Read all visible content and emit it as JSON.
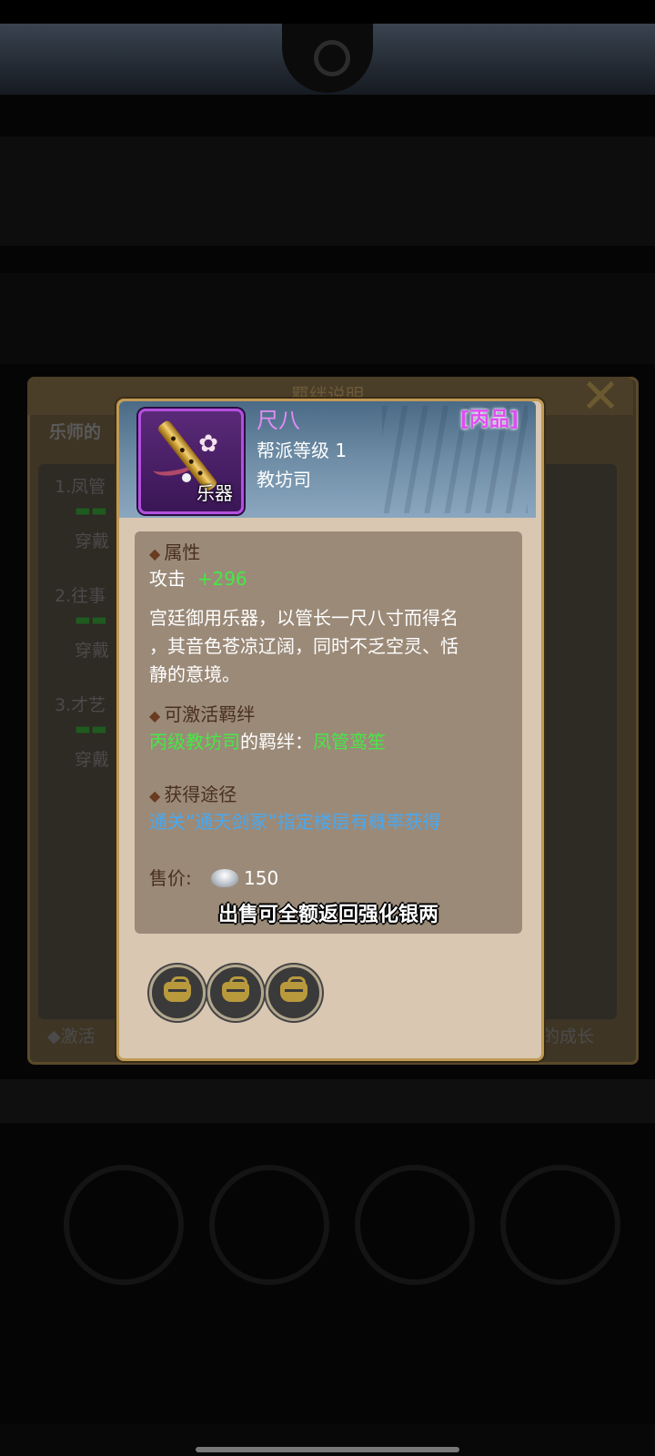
{
  "background_dialog": {
    "title": "羁绊说明",
    "heading": "乐师的",
    "entries": [
      {
        "label": "1.凤管",
        "sub": "穿戴"
      },
      {
        "label": "2.往事",
        "sub": "穿戴"
      },
      {
        "label": "3.才艺",
        "sub": "穿戴"
      }
    ],
    "footer_left": "◆激活",
    "footer_right": "的成长"
  },
  "item": {
    "name": "尺八",
    "grade": "[丙品]",
    "guild_level": "帮派等级 1",
    "department": "教坊司",
    "type_label": "乐器",
    "attributes_heading": "属性",
    "attack_label": "攻击",
    "attack_value": "+296",
    "description_lines": [
      "宫廷御用乐器，以管长一尺八寸而得名",
      "，其音色苍凉辽阔，同时不乏空灵、恬",
      "静的意境。"
    ],
    "bond_heading": "可激活羁绊",
    "bond_source": "丙级教坊司",
    "bond_mid": "的羁绊：",
    "bond_name": "凤管鸾笙",
    "obtain_heading": "获得途径",
    "obtain_text": "通关“通天剑冢”指定楼层有概率获得",
    "price_label": "售价:",
    "price_value": "150",
    "sell_note": "出售可全额返回强化银两",
    "slots": [
      "locked",
      "locked",
      "locked"
    ]
  },
  "icons": {
    "close": "close-x-icon",
    "currency": "silver-ingot-icon",
    "slot": "lock-icon"
  },
  "colors": {
    "grade_purple": "#e04cf2",
    "green_value": "#46e846",
    "blue_link": "#49a8f0",
    "card_bg": "#d9c7b2",
    "frame_gold": "#c09a55"
  }
}
